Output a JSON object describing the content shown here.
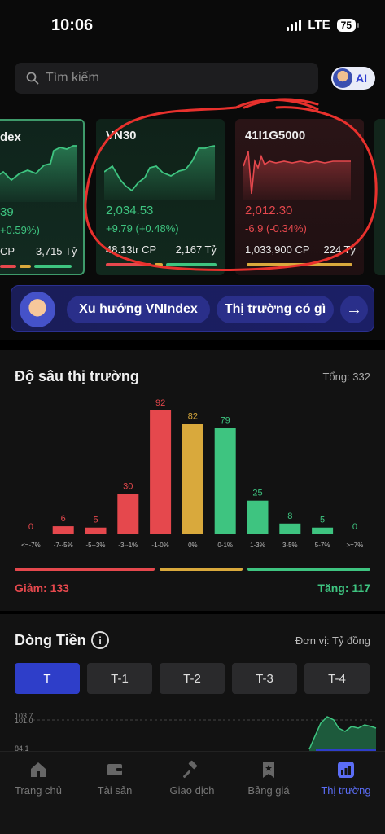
{
  "status_bar": {
    "time": "10:06",
    "network": "LTE",
    "battery": "75"
  },
  "search": {
    "placeholder": "Tìm kiếm",
    "ai_label": "AI"
  },
  "index_cards": [
    {
      "name": "dex",
      "price": "39",
      "change": "+0.59%)",
      "volume": "CP",
      "value": "3,715 Tỷ",
      "trend": "up"
    },
    {
      "name": "VN30",
      "price": "2,034.53",
      "change": "+9.79 (+0.48%)",
      "volume": "48.13tr CP",
      "value": "2,167 Tỷ",
      "trend": "up"
    },
    {
      "name": "41I1G5000",
      "price": "2,012.30",
      "change": "-6.9 (-0.34%)",
      "volume": "1,033,900 CP",
      "value": "224 Tỷ",
      "trend": "down"
    }
  ],
  "banner": {
    "pill1": "Xu hướng VNIndex",
    "pill2": "Thị trường có gì",
    "arrow": "→"
  },
  "market_depth": {
    "title": "Độ sâu thị trường",
    "total_label": "Tổng: 332",
    "decrease_label": "Giảm: 133",
    "increase_label": "Tăng: 117"
  },
  "chart_data": {
    "type": "bar",
    "categories": [
      "<=-7%",
      "-7--5%",
      "-5--3%",
      "-3--1%",
      "-1-0%",
      "0%",
      "0-1%",
      "1-3%",
      "3-5%",
      "5-7%",
      ">=7%"
    ],
    "values": [
      0,
      6,
      5,
      30,
      92,
      82,
      79,
      25,
      8,
      5,
      0
    ],
    "colors": [
      "#e5484d",
      "#e5484d",
      "#e5484d",
      "#e5484d",
      "#e5484d",
      "#d9a93c",
      "#3ec480",
      "#3ec480",
      "#3ec480",
      "#3ec480",
      "#3ec480"
    ],
    "title": "Độ sâu thị trường",
    "ylim": [
      0,
      92
    ]
  },
  "money_flow": {
    "title": "Dòng Tiền",
    "info_icon": "i",
    "unit": "Đơn vị: Tỷ đồng",
    "tabs": [
      "T",
      "T-1",
      "T-2",
      "T-3",
      "T-4"
    ],
    "active_tab": "T",
    "y_ticks": [
      "103.7",
      "101.0",
      "84.1"
    ]
  },
  "nav": [
    {
      "label": "Trang chủ",
      "icon": "home-icon"
    },
    {
      "label": "Tài sản",
      "icon": "wallet-icon"
    },
    {
      "label": "Giao dịch",
      "icon": "hammer-icon"
    },
    {
      "label": "Bảng giá",
      "icon": "bookmark-star-icon"
    },
    {
      "label": "Thị trường",
      "icon": "market-chart-icon"
    }
  ],
  "colors": {
    "up": "#3ec480",
    "down": "#e5484d",
    "neutral": "#d9a93c",
    "accent": "#2e3ec9",
    "nav_active": "#5b6df5",
    "annotation": "#e8312d"
  }
}
